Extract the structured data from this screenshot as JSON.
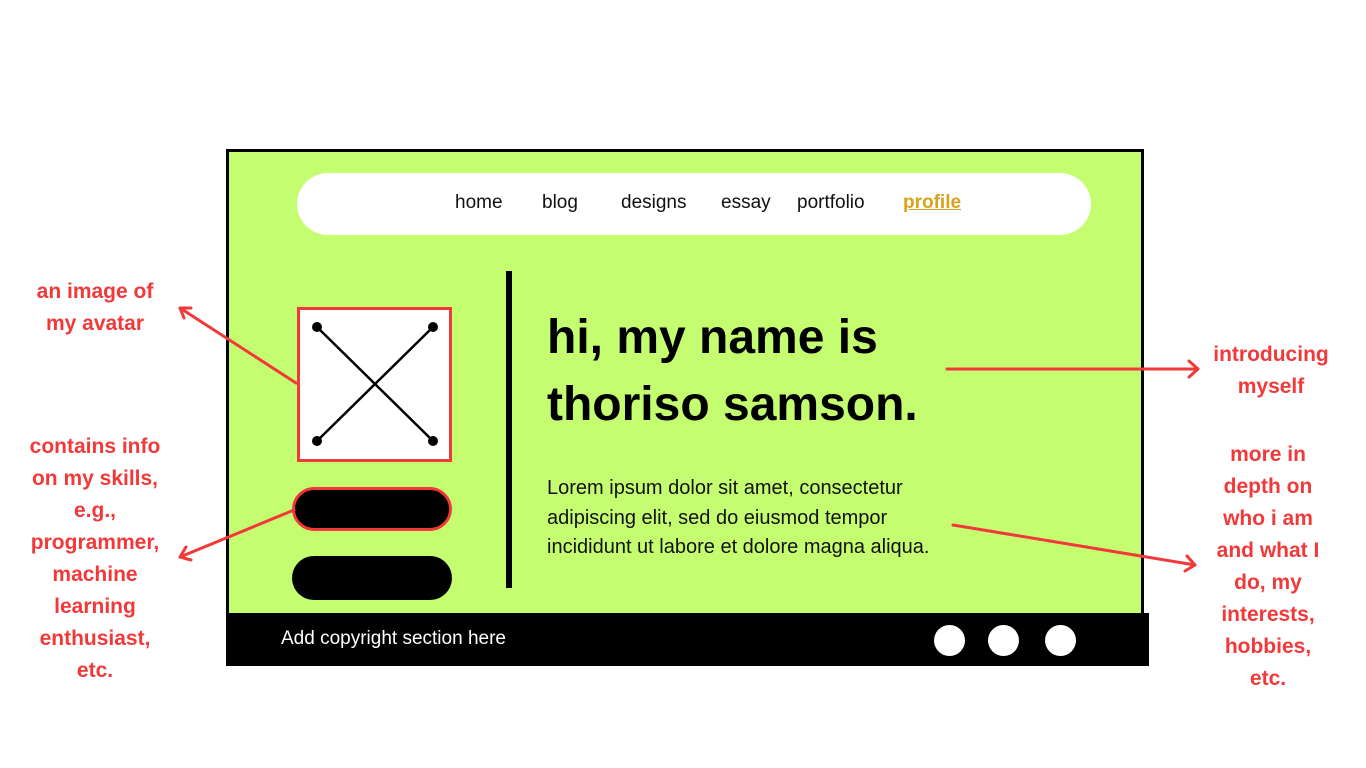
{
  "nav": {
    "items": [
      {
        "label": "home"
      },
      {
        "label": "blog"
      },
      {
        "label": "designs"
      },
      {
        "label": "essay"
      },
      {
        "label": "portfolio"
      },
      {
        "label": "profile",
        "active": true
      }
    ]
  },
  "hero": {
    "headline_line1": "hi, my name is",
    "headline_line2": "thoriso samson.",
    "body": "Lorem ipsum dolor sit amet, consectetur adipiscing elit, sed do eiusmod tempor incididunt ut labore et dolore magna aliqua."
  },
  "footer": {
    "text": "Add copyright section here"
  },
  "annotations": {
    "avatar": [
      "an image of",
      "my avatar"
    ],
    "skills": [
      "contains info",
      "on my skills,",
      "e.g.,",
      "programmer,",
      "machine",
      "learning",
      "enthusiast,",
      "etc."
    ],
    "intro": [
      "introducing",
      "myself"
    ],
    "more": [
      "more in",
      "depth on",
      "who i am",
      "and what I",
      "do, my",
      "interests,",
      "hobbies,",
      "etc."
    ]
  },
  "colors": {
    "background": "#c5fd71",
    "annotation": "#f2393a",
    "active_link": "#d8a31a",
    "footer": "#000000"
  },
  "icons": [
    "placeholder-image-icon",
    "social-dot-icon"
  ]
}
